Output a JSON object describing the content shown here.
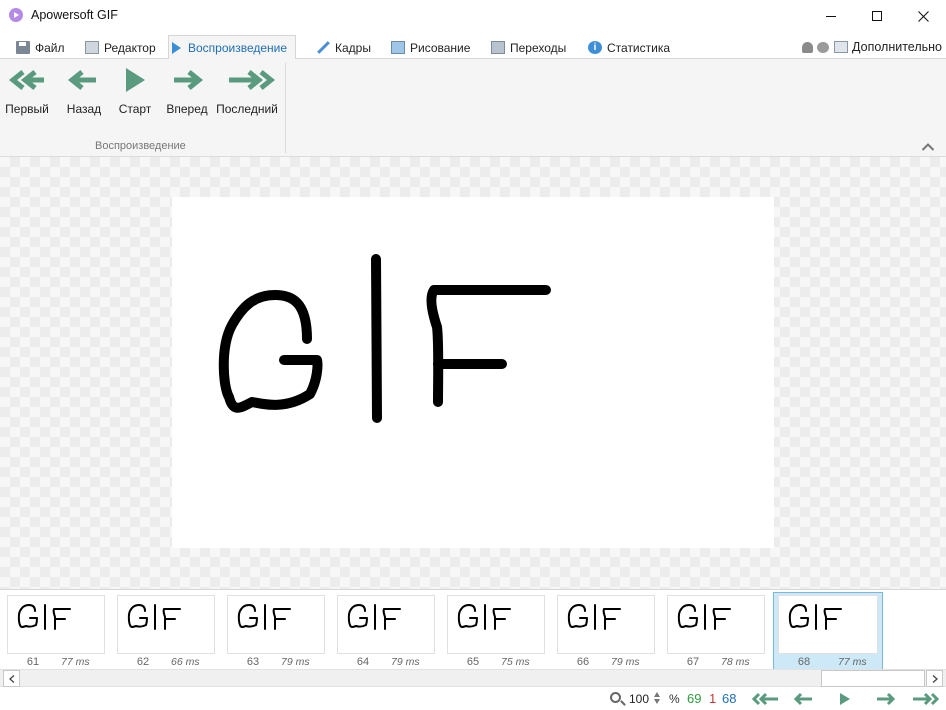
{
  "window": {
    "title": "Apowersoft GIF"
  },
  "menu": {
    "tabs": [
      {
        "label": "Файл",
        "icon": "floppy-icon"
      },
      {
        "label": "Редактор",
        "icon": "editor-icon"
      },
      {
        "label": "Воспроизведение",
        "icon": "play-icon",
        "active": true
      },
      {
        "label": "Кадры",
        "icon": "pencil-icon"
      },
      {
        "label": "Рисование",
        "icon": "picture-icon"
      },
      {
        "label": "Переходы",
        "icon": "transitions-icon"
      },
      {
        "label": "Статистика",
        "icon": "info-icon"
      }
    ],
    "more_label": "Дополнительно"
  },
  "ribbon": {
    "buttons": [
      {
        "label": "Первый",
        "icon": "double-arrow-left-icon"
      },
      {
        "label": "Назад",
        "icon": "arrow-left-icon"
      },
      {
        "label": "Старт",
        "icon": "play-triangle-icon"
      },
      {
        "label": "Вперед",
        "icon": "arrow-right-icon"
      },
      {
        "label": "Последний",
        "icon": "double-arrow-right-icon"
      }
    ],
    "group_label": "Воспроизведение",
    "accent_color": "#5a9a7e"
  },
  "canvas": {
    "frame_text": "GIF"
  },
  "filmstrip": {
    "frames": [
      {
        "number": "61",
        "duration": "77 ms"
      },
      {
        "number": "62",
        "duration": "66 ms"
      },
      {
        "number": "63",
        "duration": "79 ms"
      },
      {
        "number": "64",
        "duration": "79 ms"
      },
      {
        "number": "65",
        "duration": "75 ms"
      },
      {
        "number": "66",
        "duration": "79 ms"
      },
      {
        "number": "67",
        "duration": "78 ms"
      },
      {
        "number": "68",
        "duration": "77 ms",
        "selected": true
      }
    ]
  },
  "status": {
    "zoom": "100",
    "zoom_unit": "%",
    "frame_count": "69",
    "selected_count": "1",
    "current_frame": "68"
  }
}
